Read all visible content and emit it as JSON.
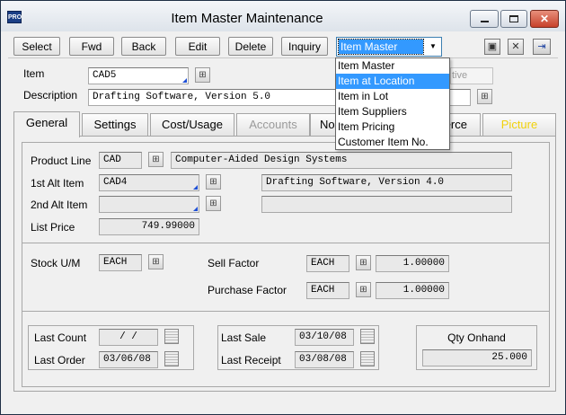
{
  "window": {
    "title": "Item Master Maintenance",
    "app_icon_text": "PRO"
  },
  "toolbar": {
    "select": "Select",
    "forward": "Fwd",
    "back": "Back",
    "edit": "Edit",
    "delete": "Delete",
    "inquiry": "Inquiry",
    "view_selected": "Item Master"
  },
  "view_menu": {
    "items": [
      "Item Master",
      "Item at Location",
      "Item in Lot",
      "Item Suppliers",
      "Item Pricing",
      "Customer Item No."
    ],
    "highlighted": "Item at Location"
  },
  "header": {
    "item_label": "Item",
    "item_value": "CAD5",
    "description_label": "Description",
    "description_value": "Drafting Software, Version 5.0",
    "status_value": "tive"
  },
  "tabs": [
    {
      "label": "General",
      "state": "active"
    },
    {
      "label": "Settings",
      "state": "normal"
    },
    {
      "label": "Cost/Usage",
      "state": "normal"
    },
    {
      "label": "Accounts",
      "state": "disabled"
    },
    {
      "label": "No",
      "state": "normal"
    },
    {
      "label": "erce",
      "state": "normal"
    },
    {
      "label": "Picture",
      "state": "highlight"
    }
  ],
  "general": {
    "product_line_label": "Product Line",
    "product_line_code": "CAD",
    "product_line_desc": "Computer-Aided Design Systems",
    "alt1_label": "1st Alt Item",
    "alt1_code": "CAD4",
    "alt1_desc": "Drafting Software, Version 4.0",
    "alt2_label": "2nd Alt Item",
    "alt2_code": "",
    "alt2_desc": "",
    "list_price_label": "List Price",
    "list_price": "749.99000",
    "stock_um_label": "Stock U/M",
    "stock_um": "EACH",
    "sell_factor_label": "Sell Factor",
    "sell_um": "EACH",
    "sell_factor": "1.00000",
    "purchase_factor_label": "Purchase Factor",
    "purchase_um": "EACH",
    "purchase_factor": "1.00000",
    "last_count_label": "Last Count",
    "last_count": "/ /",
    "last_order_label": "Last Order",
    "last_order": "03/06/08",
    "last_sale_label": "Last Sale",
    "last_sale": "03/10/08",
    "last_receipt_label": "Last Receipt",
    "last_receipt": "03/08/08",
    "qty_onhand_label": "Qty Onhand",
    "qty_onhand": "25.000"
  },
  "colors": {
    "selection": "#3399ff",
    "required_marker": "#1e4fd6",
    "picture_tab": "#f1d10a",
    "close_button": "#c7412b"
  },
  "icons": [
    "save-icon",
    "delete-record-icon",
    "exit-icon",
    "lookup-icon",
    "calendar-icon",
    "minimize-icon",
    "maximize-icon",
    "close-icon"
  ]
}
